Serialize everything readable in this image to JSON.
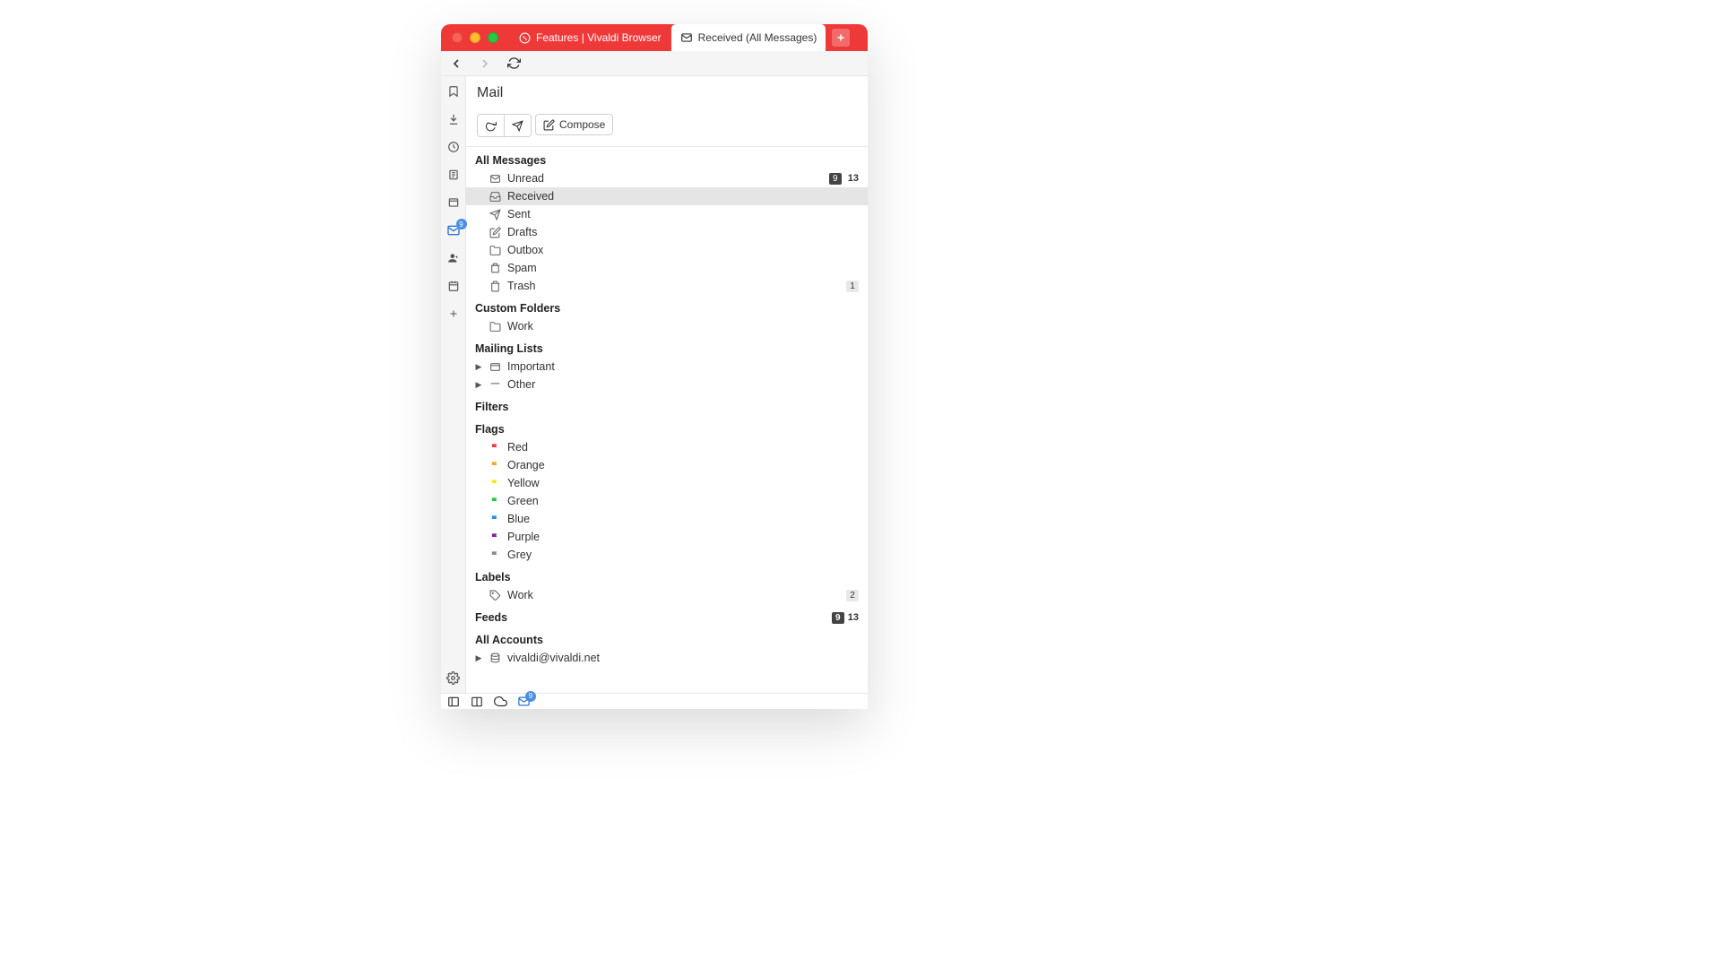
{
  "tabs": {
    "tab1": {
      "label": "Features | Vivaldi Browser"
    },
    "tab2": {
      "label": "Received (All Messages)"
    }
  },
  "sidebar": {
    "mail_badge": "9"
  },
  "mail": {
    "title": "Mail",
    "compose": "Compose",
    "sections": {
      "all_messages": "All Messages",
      "custom_folders": "Custom Folders",
      "mailing_lists": "Mailing Lists",
      "filters": "Filters",
      "flags": "Flags",
      "labels": "Labels",
      "feeds": "Feeds",
      "all_accounts": "All Accounts"
    },
    "items": {
      "unread": {
        "label": "Unread",
        "badge": "9",
        "count": "13"
      },
      "received": {
        "label": "Received"
      },
      "sent": {
        "label": "Sent"
      },
      "drafts": {
        "label": "Drafts"
      },
      "outbox": {
        "label": "Outbox"
      },
      "spam": {
        "label": "Spam"
      },
      "trash": {
        "label": "Trash",
        "count": "1"
      },
      "work_folder": {
        "label": "Work"
      },
      "important": {
        "label": "Important"
      },
      "other": {
        "label": "Other"
      },
      "flag_red": "Red",
      "flag_orange": "Orange",
      "flag_yellow": "Yellow",
      "flag_green": "Green",
      "flag_blue": "Blue",
      "flag_purple": "Purple",
      "flag_grey": "Grey",
      "label_work": {
        "label": "Work",
        "count": "2"
      },
      "feeds_meta": {
        "badge": "9",
        "count": "13"
      },
      "account1": "vivaldi@vivaldi.net"
    }
  },
  "statusbar": {
    "mail_badge": "9"
  },
  "colors": {
    "red": "#ef3939",
    "orange": "#f5a623",
    "yellow": "#f8e71c",
    "green": "#27c93f",
    "blue": "#2b8ce6",
    "purple": "#9013a8",
    "grey": "#888888"
  }
}
